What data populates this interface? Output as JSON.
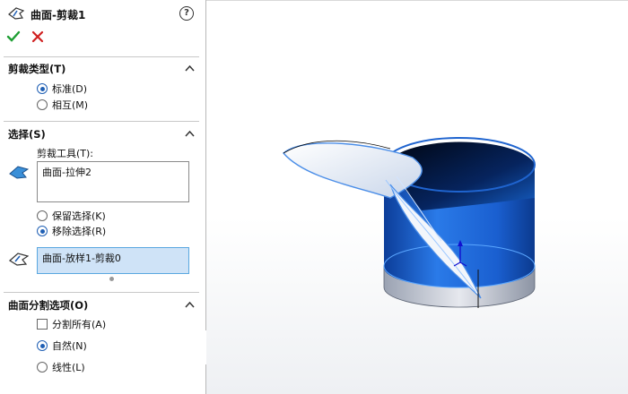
{
  "property_manager": {
    "title": "曲面-剪裁1",
    "help_symbol": "?"
  },
  "trim_type": {
    "title": "剪裁类型(T)",
    "options": [
      {
        "label": "标准(D)",
        "selected": true
      },
      {
        "label": "相互(M)",
        "selected": false
      }
    ]
  },
  "selections": {
    "title": "选择(S)",
    "trim_tool_label": "剪裁工具(T):",
    "trim_tool_value": "曲面-拉伸2",
    "keep_remove": [
      {
        "label": "保留选择(K)",
        "selected": false
      },
      {
        "label": "移除选择(R)",
        "selected": true
      }
    ],
    "pieces_value": "曲面-放样1-剪裁0"
  },
  "split_options": {
    "title": "曲面分割选项(O)",
    "split_all": {
      "label": "分割所有(A)",
      "checked": false
    },
    "options": [
      {
        "label": "自然(N)",
        "selected": true
      },
      {
        "label": "线性(L)",
        "selected": false
      }
    ]
  },
  "colors": {
    "accent": "#1f5fb4",
    "ok_green": "#1e9e33",
    "cancel_red": "#d02020",
    "active_field": "#cfe3f7",
    "model_blue": "#1c63c9"
  },
  "icons": {
    "feature": "surface-trim-icon",
    "help": "help-icon",
    "ok": "checkmark-icon",
    "cancel": "close-icon"
  }
}
